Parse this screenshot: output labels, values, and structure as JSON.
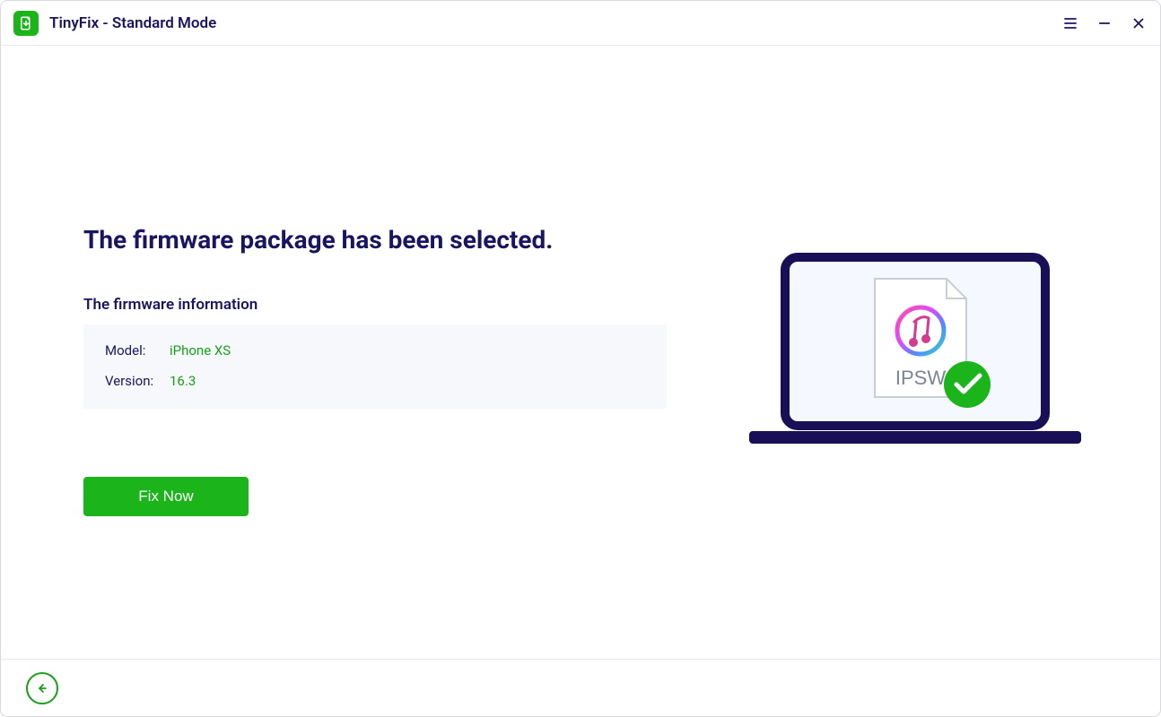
{
  "titlebar": {
    "title": "TinyFix - Standard Mode"
  },
  "main": {
    "headline": "The firmware package has been selected.",
    "subhead": "The firmware information",
    "info": {
      "model_label": "Model:",
      "model_value": "iPhone XS",
      "version_label": "Version:",
      "version_value": "16.3"
    },
    "fix_button_label": "Fix Now",
    "illustration": {
      "file_label": "IPSW"
    }
  }
}
